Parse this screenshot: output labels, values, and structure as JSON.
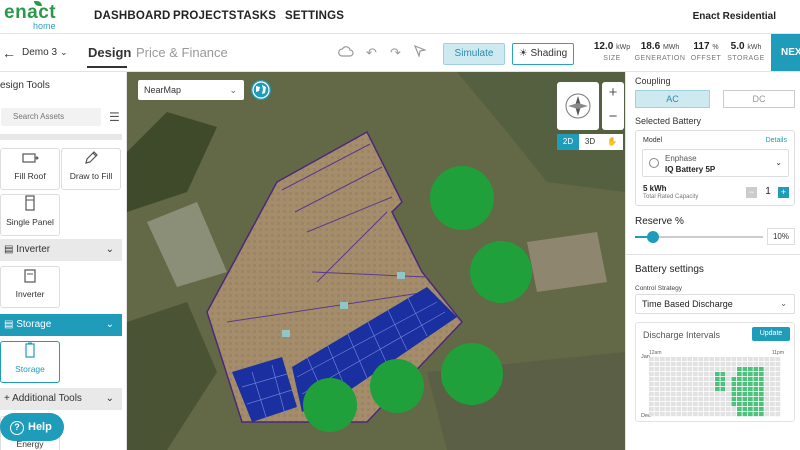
{
  "brand": {
    "name": "enact",
    "tagline": "home"
  },
  "nav": {
    "items": [
      "DASHBOARD",
      "PROJECTS",
      "TASKS",
      "SETTINGS"
    ],
    "org": "Enact Residential"
  },
  "project": {
    "name": "Demo 3"
  },
  "tabs": {
    "design": "Design",
    "price": "Price & Finance"
  },
  "toolbar": {
    "simulate": "Simulate",
    "shading": "Shading"
  },
  "stats": [
    {
      "value": "12.0",
      "unit": "kWp",
      "label": "SIZE"
    },
    {
      "value": "18.6",
      "unit": "MWh",
      "label": "GENERATION"
    },
    {
      "value": "117",
      "unit": "%",
      "label": "OFFSET"
    },
    {
      "value": "5.0",
      "unit": "kWh",
      "label": "STORAGE"
    }
  ],
  "next": "NEXT",
  "sidebar": {
    "title": "esign Tools",
    "search_placeholder": "Search Assets",
    "tools": {
      "fill_roof": "Fill Roof",
      "draw_to_fill": "Draw to Fill",
      "single_panel": "Single Panel",
      "inverter": "Inverter",
      "storage": "Storage",
      "energy": "Energy"
    },
    "sections": {
      "inverter": "Inverter",
      "storage": "Storage",
      "additional": "+ Additional Tools"
    },
    "help": "Help"
  },
  "map": {
    "source": "NearMap",
    "view_2d": "2D",
    "view_3d": "3D"
  },
  "panel": {
    "coupling_label": "Coupling",
    "coupling_ac": "AC",
    "coupling_dc": "DC",
    "selected_battery_label": "Selected Battery",
    "model_label": "Model",
    "details": "Details",
    "brand": "Enphase",
    "product": "IQ Battery 5P",
    "capacity": "5 kWh",
    "capacity_label": "Total Rated Capacity",
    "quantity": "1",
    "reserve_label": "Reserve %",
    "reserve_value": "10%",
    "reserve_fraction": 0.14,
    "battery_settings_label": "Battery settings",
    "control_strategy_label": "Control Strategy",
    "control_strategy": "Time Based Discharge",
    "discharge_title": "Discharge Intervals",
    "update": "Update",
    "time_start": "12am",
    "time_end": "11pm",
    "month_start": "Jan",
    "month_end": "Dec"
  },
  "colors": {
    "accent": "#1f9cba",
    "brand_green": "#2a9a4a",
    "tree": "#1fa03a",
    "panel": "#1a2fa0"
  }
}
